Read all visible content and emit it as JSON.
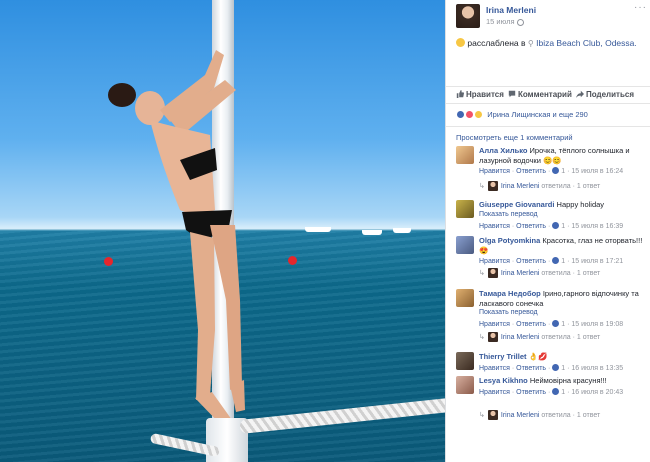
{
  "post": {
    "author": "Irina Merleni",
    "date": "15 июля",
    "status_prefix": "расслаблена в",
    "location": "Ibiza Beach Club, Odessa.",
    "more_label": "···"
  },
  "actions": {
    "like": "Нравится",
    "comment": "Комментарий",
    "share": "Поделиться"
  },
  "reactions": {
    "text": "Ирина Лищинская и еще 290"
  },
  "show_more": "Просмотреть еще 1 комментарий",
  "comments": [
    {
      "name": "Алла Хилько",
      "text": "Ирочка, тёплого солнышка и лазурной водочки 😊😊",
      "like": "Нравится",
      "reply": "Ответить",
      "likes": "1",
      "time": "15 июля в 16:24",
      "avatar_color": "#d9a066",
      "reply_author": "Irina Merleni",
      "reply_text": "ответила · 1 ответ"
    },
    {
      "name": "Giuseppe Giovanardi",
      "text": "Happy holiday",
      "translate": "Показать перевод",
      "like": "Нравится",
      "reply": "Ответить",
      "likes": "1",
      "time": "15 июля в 16:39",
      "avatar_color": "#8a7a30"
    },
    {
      "name": "Olga Potyomkina",
      "text": "Красотка, глаз не оторвать!!! 😍",
      "like": "Нравится",
      "reply": "Ответить",
      "likes": "1",
      "time": "15 июля в 17:21",
      "avatar_color": "#6e7fa8",
      "reply_author": "Irina Merleni",
      "reply_text": "ответила · 1 ответ"
    },
    {
      "name": "Тамара Недобор",
      "text": "Iрино,гарного вiдпочинку та ласкавого сонечка",
      "translate": "Показать перевод",
      "like": "Нравится",
      "reply": "Ответить",
      "likes": "1",
      "time": "15 июля в 19:08",
      "avatar_color": "#b58a4a",
      "reply_author": "Irina Merleni",
      "reply_text": "ответила · 1 ответ"
    },
    {
      "name": "Thierry Trillet",
      "text": "👌💋",
      "like": "Нравится",
      "reply": "Ответить",
      "likes": "1",
      "time": "16 июля в 13:35",
      "avatar_color": "#5a4a3a"
    },
    {
      "name": "Lesya Kikhno",
      "text": "Неймовiрна красуня!!!",
      "like": "Нравится",
      "reply": "Ответить",
      "likes": "1",
      "time": "16 июля в 20:43",
      "avatar_color": "#a87f6a",
      "reply_author": "Irina Merleni",
      "reply_text": "ответила · 1 ответ"
    }
  ],
  "colors": {
    "link": "#365899",
    "meta": "#90949c",
    "like_blue": "#4267b2"
  }
}
